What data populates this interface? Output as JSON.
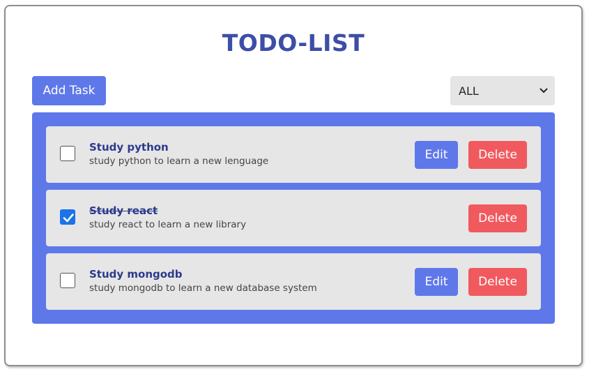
{
  "app": {
    "title": "TODO-LIST"
  },
  "toolbar": {
    "add_label": "Add Task",
    "filter": {
      "selected": "ALL",
      "icon": "chevron-down-icon"
    }
  },
  "colors": {
    "title": "#3d4ea6",
    "accent": "#5e78ea",
    "danger": "#f05a5e",
    "item_bg": "#e6e6e6",
    "check": "#1a73e8"
  },
  "tasks": [
    {
      "title": "Study python",
      "description": "study python to learn a new lenguage",
      "completed": false,
      "edit_label": "Edit",
      "delete_label": "Delete"
    },
    {
      "title": "Study react",
      "description": "study react to learn a new library",
      "completed": true,
      "delete_label": "Delete"
    },
    {
      "title": "Study mongodb",
      "description": "study mongodb to learn a new database system",
      "completed": false,
      "edit_label": "Edit",
      "delete_label": "Delete"
    }
  ]
}
